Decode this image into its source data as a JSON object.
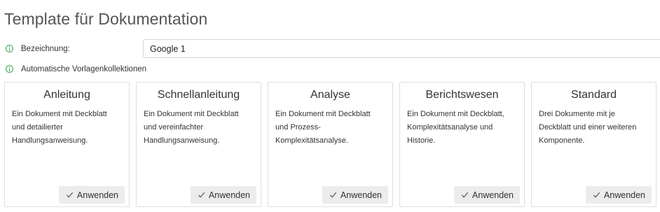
{
  "page": {
    "title": "Template für Dokumentation"
  },
  "name_field": {
    "label": "Bezeichnung:",
    "value": "Google 1"
  },
  "collections": {
    "label": "Automatische Vorlagenkollektionen"
  },
  "colors": {
    "info_icon": "#3aa655",
    "button_bg": "#ececec"
  },
  "cards": [
    {
      "title": "Anleitung",
      "lines": [
        "Ein Dokument mit Deckblatt",
        "und detailierter",
        "Handlungsanweisung."
      ],
      "button": "Anwenden"
    },
    {
      "title": "Schnellanleitung",
      "lines": [
        "Ein Dokument mit Deckblatt",
        "und vereinfachter",
        "Handlungsanweisung."
      ],
      "button": "Anwenden"
    },
    {
      "title": "Analyse",
      "lines": [
        "Ein Dokument mit Deckblatt",
        "und Prozess-",
        "Komplexitätsanalyse."
      ],
      "button": "Anwenden"
    },
    {
      "title": "Berichtswesen",
      "lines": [
        "Ein Dokument mit Deckblatt,",
        "Komplexitätsanalyse und",
        "Historie."
      ],
      "button": "Anwenden"
    },
    {
      "title": "Standard",
      "lines": [
        "Drei Dokumente mit je",
        "Deckblatt und einer weiteren",
        "Komponente."
      ],
      "button": "Anwenden"
    }
  ]
}
